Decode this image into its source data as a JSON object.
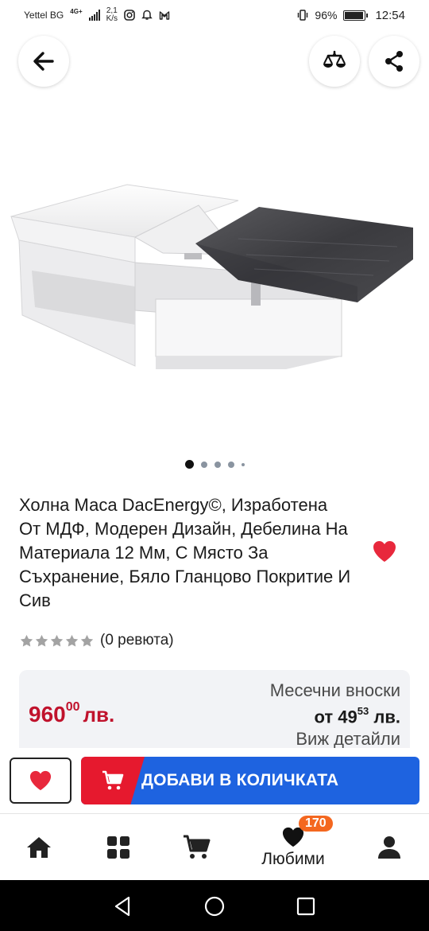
{
  "status_bar": {
    "carrier": "Yettel BG",
    "network": "4G+",
    "net_speed_value": "2,1",
    "net_speed_unit": "K/s",
    "battery": "96%",
    "time": "12:54"
  },
  "top_actions": {
    "back_icon": "arrow-left-icon",
    "compare_icon": "scales-icon",
    "share_icon": "share-icon"
  },
  "carousel": {
    "total": 5,
    "active_index": 0
  },
  "product": {
    "title": "Холна Маса DacEnergy©, Изработена От МДФ, Модерен Дизайн, Дебелина На Материала 12 Мм, С Място За Съхранение, Бяло Гланцово Покритие И Сив",
    "favorite": true,
    "rating": 0,
    "stars_total": 5,
    "review_count_text": "(0 ревюта)"
  },
  "price_box": {
    "price_main": "960",
    "price_cents": "00",
    "currency": "лв.",
    "installments_title": "Месечни вноски",
    "installments_prefix": "от",
    "installments_main": "49",
    "installments_cents": "53",
    "installments_currency": "лв.",
    "installments_details": "Виж детайли"
  },
  "cart_bar": {
    "add_to_cart_label": "ДОБАВИ В КОЛИЧКАТА"
  },
  "bottom_nav": {
    "items": [
      {
        "icon": "home-icon",
        "label": ""
      },
      {
        "icon": "grid-icon",
        "label": ""
      },
      {
        "icon": "cart-icon",
        "label": ""
      },
      {
        "icon": "heart-icon",
        "label": "Любими",
        "badge": "170"
      },
      {
        "icon": "user-icon",
        "label": ""
      }
    ]
  },
  "colors": {
    "accent_red": "#c0122c",
    "button_blue": "#1e63e0",
    "cart_red": "#e6192e",
    "badge_orange": "#f4671f",
    "heart_red": "#e8283c"
  }
}
